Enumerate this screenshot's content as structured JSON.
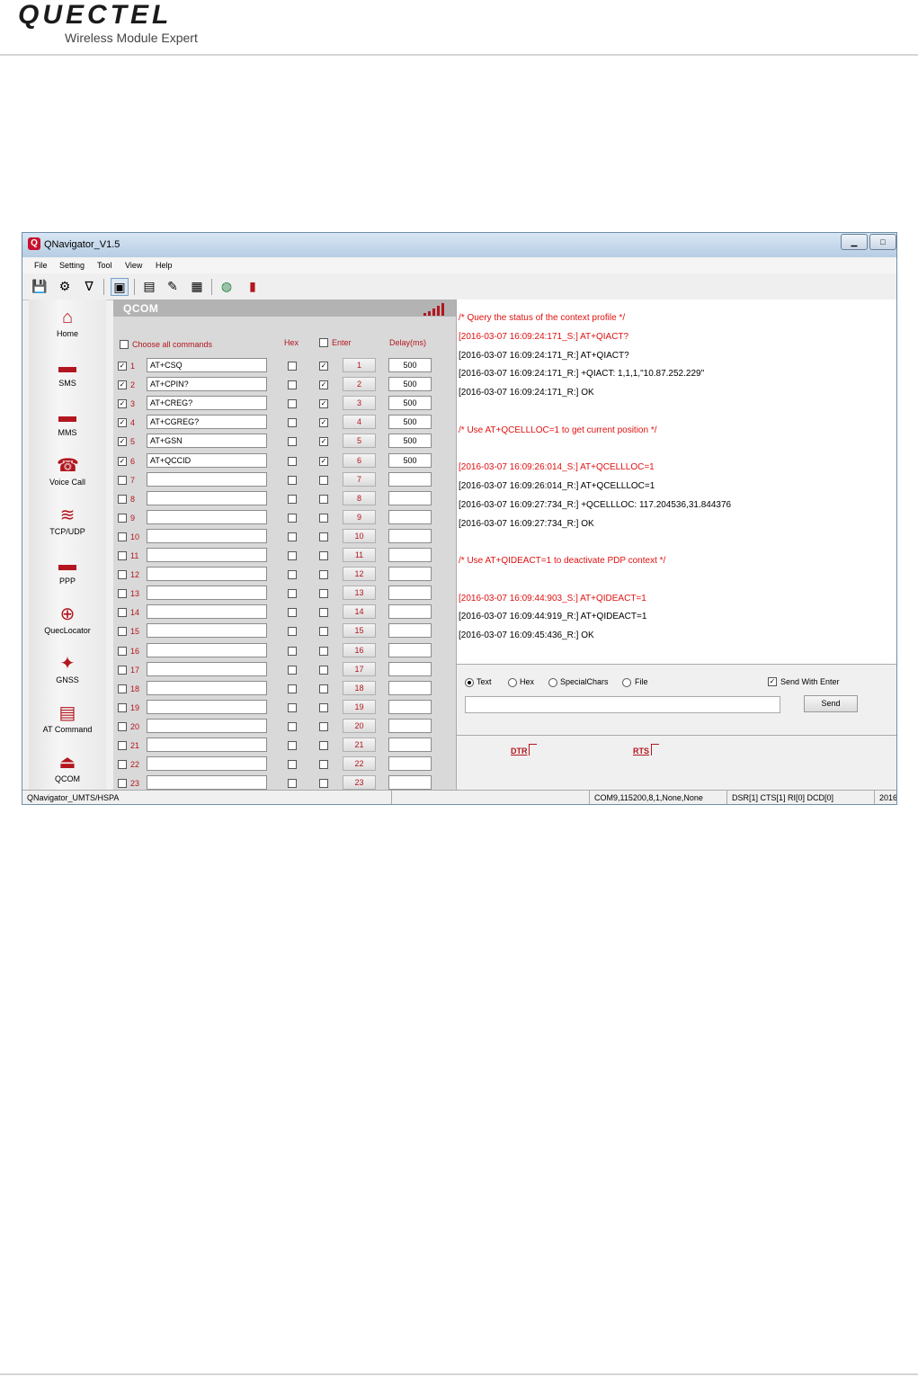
{
  "page": {
    "brand": "QUECTEL",
    "tagline": "Wireless Module Expert"
  },
  "window": {
    "title": "QNavigator_V1.5",
    "controls": [
      "minimize",
      "maximize"
    ],
    "menu": [
      "File",
      "Setting",
      "Tool",
      "View",
      "Help"
    ],
    "toolbar_icons": [
      "save-icon",
      "settings-icon",
      "filter-icon",
      "qcom-icon",
      "log-icon",
      "clean-icon",
      "calculator-icon",
      "globe-icon",
      "book-icon"
    ]
  },
  "sidebar": {
    "items": [
      {
        "label": "Home",
        "icon": "home-icon",
        "glyph": "🏠"
      },
      {
        "label": "SMS",
        "icon": "sms-icon",
        "glyph": "💬"
      },
      {
        "label": "MMS",
        "icon": "mms-icon",
        "glyph": "💬"
      },
      {
        "label": "Voice Call",
        "icon": "phone-icon",
        "glyph": "☎"
      },
      {
        "label": "TCP/UDP",
        "icon": "wifi-icon",
        "glyph": "≋"
      },
      {
        "label": "PPP",
        "icon": "ppp-icon",
        "glyph": "💬"
      },
      {
        "label": "QuecLocator",
        "icon": "locator-icon",
        "glyph": "⊕"
      },
      {
        "label": "GNSS",
        "icon": "satellite-icon",
        "glyph": "✦"
      },
      {
        "label": "AT Command",
        "icon": "document-icon",
        "glyph": "▤"
      },
      {
        "label": "QCOM",
        "icon": "qcom-icon",
        "glyph": "⏏"
      }
    ]
  },
  "qcom": {
    "title": "QCOM",
    "choose_all_label": "Choose all commands",
    "hex_header": "Hex",
    "enter_header": "Enter",
    "delay_header": "Delay(ms)",
    "rows": [
      {
        "n": "1",
        "cmd": "AT+CSQ",
        "checked": true,
        "hex": false,
        "enter": true,
        "delay": "500"
      },
      {
        "n": "2",
        "cmd": "AT+CPIN?",
        "checked": true,
        "hex": false,
        "enter": true,
        "delay": "500"
      },
      {
        "n": "3",
        "cmd": "AT+CREG?",
        "checked": true,
        "hex": false,
        "enter": true,
        "delay": "500"
      },
      {
        "n": "4",
        "cmd": "AT+CGREG?",
        "checked": true,
        "hex": false,
        "enter": true,
        "delay": "500"
      },
      {
        "n": "5",
        "cmd": "AT+GSN",
        "checked": true,
        "hex": false,
        "enter": true,
        "delay": "500"
      },
      {
        "n": "6",
        "cmd": "AT+QCCID",
        "checked": true,
        "hex": false,
        "enter": true,
        "delay": "500"
      },
      {
        "n": "7",
        "cmd": "",
        "checked": false,
        "hex": false,
        "enter": false,
        "delay": ""
      },
      {
        "n": "8",
        "cmd": "",
        "checked": false,
        "hex": false,
        "enter": false,
        "delay": ""
      },
      {
        "n": "9",
        "cmd": "",
        "checked": false,
        "hex": false,
        "enter": false,
        "delay": ""
      },
      {
        "n": "10",
        "cmd": "",
        "checked": false,
        "hex": false,
        "enter": false,
        "delay": ""
      },
      {
        "n": "11",
        "cmd": "",
        "checked": false,
        "hex": false,
        "enter": false,
        "delay": ""
      },
      {
        "n": "12",
        "cmd": "",
        "checked": false,
        "hex": false,
        "enter": false,
        "delay": ""
      },
      {
        "n": "13",
        "cmd": "",
        "checked": false,
        "hex": false,
        "enter": false,
        "delay": ""
      },
      {
        "n": "14",
        "cmd": "",
        "checked": false,
        "hex": false,
        "enter": false,
        "delay": ""
      },
      {
        "n": "15",
        "cmd": "",
        "checked": false,
        "hex": false,
        "enter": false,
        "delay": ""
      },
      {
        "n": "16",
        "cmd": "",
        "checked": false,
        "hex": false,
        "enter": false,
        "delay": ""
      },
      {
        "n": "17",
        "cmd": "",
        "checked": false,
        "hex": false,
        "enter": false,
        "delay": ""
      },
      {
        "n": "18",
        "cmd": "",
        "checked": false,
        "hex": false,
        "enter": false,
        "delay": ""
      },
      {
        "n": "19",
        "cmd": "",
        "checked": false,
        "hex": false,
        "enter": false,
        "delay": ""
      },
      {
        "n": "20",
        "cmd": "",
        "checked": false,
        "hex": false,
        "enter": false,
        "delay": ""
      },
      {
        "n": "21",
        "cmd": "",
        "checked": false,
        "hex": false,
        "enter": false,
        "delay": ""
      },
      {
        "n": "22",
        "cmd": "",
        "checked": false,
        "hex": false,
        "enter": false,
        "delay": ""
      },
      {
        "n": "23",
        "cmd": "",
        "checked": false,
        "hex": false,
        "enter": false,
        "delay": ""
      }
    ]
  },
  "log": {
    "lines": [
      {
        "text": "/* Query the status of the context profile */",
        "color": "#e01010",
        "gap": false
      },
      {
        "text": "[2016-03-07 16:09:24:171_S:] AT+QIACT?",
        "color": "#e01010",
        "gap": false
      },
      {
        "text": "[2016-03-07 16:09:24:171_R:] AT+QIACT?",
        "color": "#000000",
        "gap": false
      },
      {
        "text": "[2016-03-07 16:09:24:171_R:] +QIACT: 1,1,1,\"10.87.252.229\"",
        "color": "#000000",
        "gap": false
      },
      {
        "text": "[2016-03-07 16:09:24:171_R:] OK",
        "color": "#000000",
        "gap": true
      },
      {
        "text": "/* Use AT+QCELLLOC=1 to get current position */",
        "color": "#e01010",
        "gap": true
      },
      {
        "text": "[2016-03-07 16:09:26:014_S:] AT+QCELLLOC=1",
        "color": "#e01010",
        "gap": false
      },
      {
        "text": "[2016-03-07 16:09:26:014_R:] AT+QCELLLOC=1",
        "color": "#000000",
        "gap": false
      },
      {
        "text": "[2016-03-07 16:09:27:734_R:] +QCELLLOC: 117.204536,31.844376",
        "color": "#000000",
        "gap": false
      },
      {
        "text": "[2016-03-07 16:09:27:734_R:] OK",
        "color": "#000000",
        "gap": true
      },
      {
        "text": "/* Use AT+QIDEACT=1 to deactivate PDP context */",
        "color": "#e01010",
        "gap": true
      },
      {
        "text": "[2016-03-07 16:09:44:903_S:] AT+QIDEACT=1",
        "color": "#e01010",
        "gap": false
      },
      {
        "text": "[2016-03-07 16:09:44:919_R:] AT+QIDEACT=1",
        "color": "#000000",
        "gap": false
      },
      {
        "text": "[2016-03-07 16:09:45:436_R:] OK",
        "color": "#000000",
        "gap": false
      }
    ]
  },
  "send": {
    "options": [
      {
        "label": "Text",
        "selected": true
      },
      {
        "label": "Hex",
        "selected": false
      },
      {
        "label": "SpecialChars",
        "selected": false
      },
      {
        "label": "File",
        "selected": false
      }
    ],
    "send_with_enter_label": "Send With Enter",
    "send_with_enter_checked": true,
    "input_value": "",
    "send_label": "Send"
  },
  "signals": {
    "dtr": "DTR",
    "rts": "RTS"
  },
  "status": {
    "app": "QNavigator_UMTS/HSPA",
    "blank": "",
    "port": "COM9,115200,8,1,None,None",
    "lines": "DSR[1] CTS[1] RI[0] DCD[0]",
    "date": "2016-"
  },
  "colors": {
    "accent_red": "#b3161e",
    "log_red": "#e01010",
    "panel_grey": "#d9d9d9"
  }
}
